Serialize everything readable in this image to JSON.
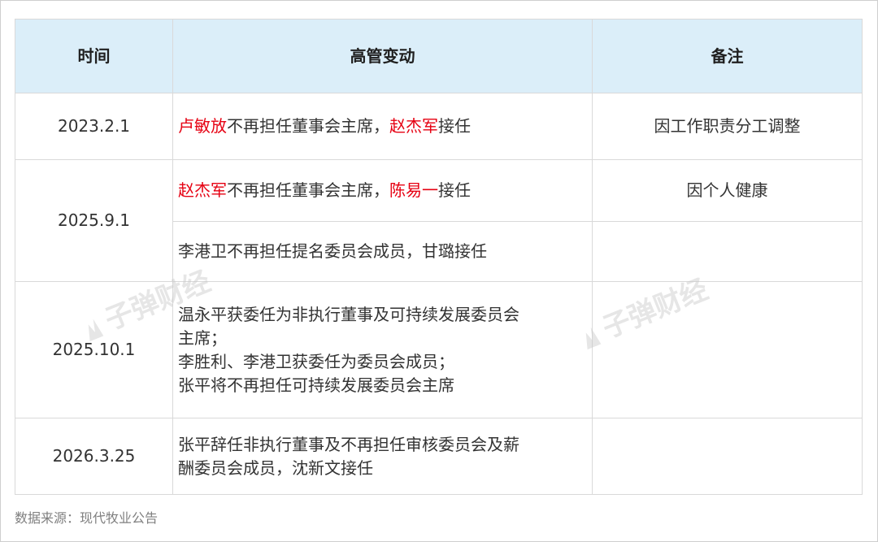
{
  "table": {
    "headers": [
      "时间",
      "高管变动",
      "备注"
    ],
    "rows": [
      {
        "date": "2023.2.1",
        "change": {
          "p1": "卢敏放",
          "p2": "不再担任董事会主席，",
          "p3": "赵杰军",
          "p4": "接任"
        },
        "note": "因工作职责分工调整"
      },
      {
        "date": "2025.9.1",
        "change": {
          "p1": "赵杰军",
          "p2": "不再担任董事会主席，",
          "p3": "陈易一",
          "p4": "接任"
        },
        "note": "因个人健康",
        "sub_change": "李港卫不再担任提名委员会成员，甘璐接任",
        "sub_note": ""
      },
      {
        "date": "2025.10.1",
        "change_lines": [
          "温永平获委任为非执行董事及可持续发展委员会",
          "主席；",
          "李胜利、李港卫获委任为委员会成员；",
          "张平将不再担任可持续发展委员会主席"
        ],
        "note": ""
      },
      {
        "date": "2026.3.25",
        "change_lines": [
          "张平辞任非执行董事及不再担任审核委员会及薪",
          "酬委员会成员，沈新文接任"
        ],
        "note": ""
      }
    ]
  },
  "source": "数据来源：现代牧业公告",
  "watermark": "子弹财经",
  "colors": {
    "header_bg": "#dbeef9",
    "highlight": "#e60012",
    "border": "#d9d9d9"
  }
}
